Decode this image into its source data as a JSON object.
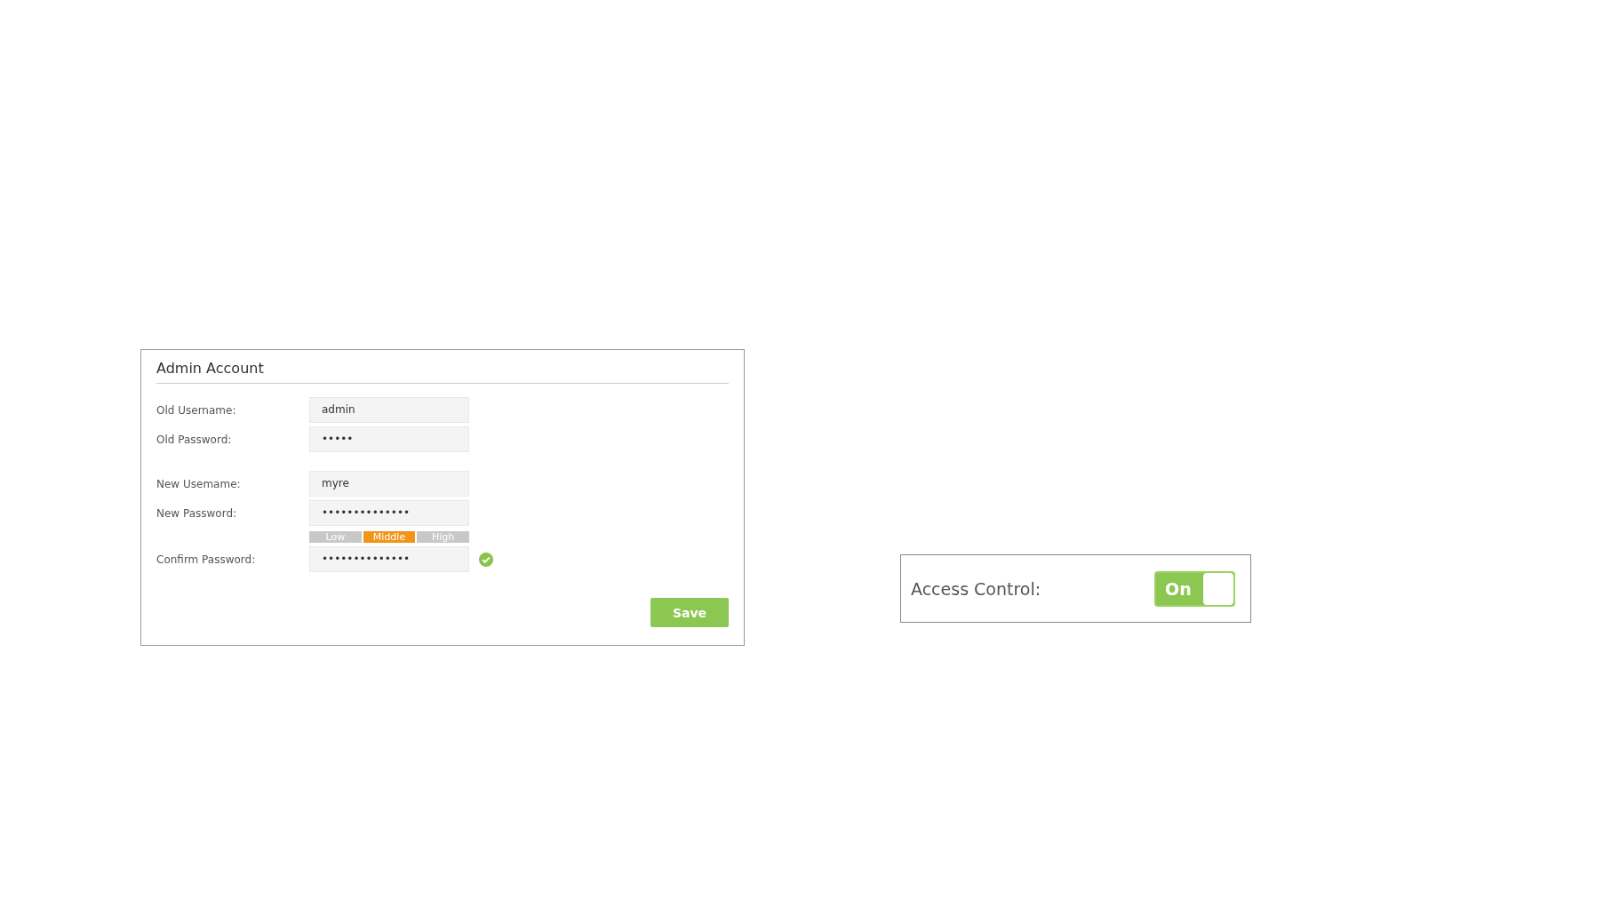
{
  "admin_account": {
    "title": "Admin Account",
    "field_groups": [
      [
        {
          "label": "Old Username:",
          "value": "admin"
        },
        {
          "label": "Old Password:",
          "value": "•••••"
        }
      ],
      [
        {
          "label": "New Usemame:",
          "value": "myre"
        },
        {
          "label": "New Password:",
          "value": "••••••••••••••",
          "strength": [
            {
              "label": "Low",
              "selected": false
            },
            {
              "label": "Middle",
              "selected": true
            },
            {
              "label": "High",
              "selected": false
            }
          ]
        },
        {
          "label": "Confirm Password:",
          "value": "••••••••••••••",
          "match": true
        }
      ]
    ],
    "save_button": "Save"
  },
  "access_control": {
    "label": "Access Control:",
    "toggle": {
      "label": "On",
      "on": true
    }
  }
}
